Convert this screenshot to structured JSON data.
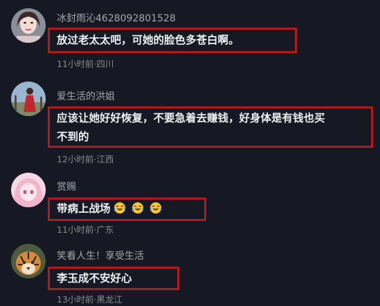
{
  "comments": [
    {
      "username": "冰封雨沁4628092801528",
      "text_lines": [
        "放过老太太吧，可她的脸色多苍白啊。"
      ],
      "meta": "11小时前·四川",
      "avatar": "woman-portrait-avatar"
    },
    {
      "username": "爱生活的洪姐",
      "text_lines": [
        "应该让她好好恢复，不要急着去赚钱，好身体是有钱也买",
        "不到的"
      ],
      "meta": "12小时前·江西",
      "avatar": "woman-red-dress-avatar"
    },
    {
      "username": "赏赐",
      "text_lines": [
        "带病上战场"
      ],
      "emojis": [
        "laugh-cry-emoji",
        "laugh-cry-emoji",
        "laugh-cry-emoji"
      ],
      "meta": "11小时前·广东",
      "avatar": "anime-girl-avatar"
    },
    {
      "username": "笑看人生！享受生活",
      "text_lines": [
        "李玉成不安好心"
      ],
      "meta": "13小时前·黑龙江",
      "avatar": "tiger-avatar"
    }
  ],
  "colors": {
    "background": "#161823",
    "highlight_box": "#b21b1b",
    "username": "#a6a8ad",
    "text": "#eef0f3",
    "meta": "#8a8c92"
  }
}
